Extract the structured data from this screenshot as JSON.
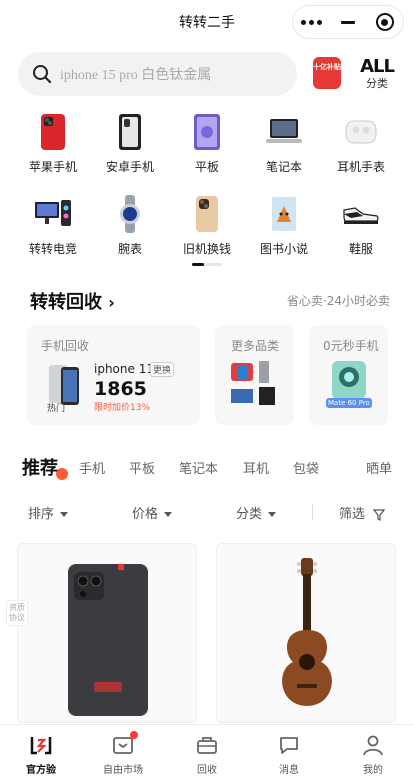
{
  "titlebar": {
    "title": "转转二手"
  },
  "search": {
    "placeholder": "iphone 15 pro 白色钛金属",
    "subsidy_badge": "十亿补贴",
    "all_line1": "ALL",
    "all_line2": "分类"
  },
  "categories": [
    {
      "label": "苹果手机",
      "icon": "iphone-icon"
    },
    {
      "label": "安卓手机",
      "icon": "android-phone-icon"
    },
    {
      "label": "平板",
      "icon": "tablet-icon"
    },
    {
      "label": "笔记本",
      "icon": "laptop-icon"
    },
    {
      "label": "耳机手表",
      "icon": "earbuds-icon"
    },
    {
      "label": "转转电竞",
      "icon": "gaming-pc-icon"
    },
    {
      "label": "腕表",
      "icon": "watch-icon"
    },
    {
      "label": "旧机换钱",
      "icon": "old-phone-icon"
    },
    {
      "label": "图书小说",
      "icon": "book-icon"
    },
    {
      "label": "鞋服",
      "icon": "sneaker-icon"
    }
  ],
  "recycle": {
    "title": "转转回收",
    "subtitle": "省心卖·24小时必卖",
    "phone_card": {
      "title": "手机回收",
      "model": "iphone 11",
      "swap": "更换",
      "price": "1865",
      "hot": "热门",
      "promo": "限时加价13%"
    },
    "more_card": {
      "title": "更多品类"
    },
    "zero_card": {
      "title": "0元秒手机",
      "phone_label": "Mate 60 Pro"
    }
  },
  "tabs": {
    "main": "推荐",
    "items": [
      "手机",
      "平板",
      "笔记本",
      "耳机",
      "包袋",
      "晒单"
    ]
  },
  "filters": {
    "sort": "排序",
    "price": "价格",
    "category": "分类",
    "filter": "筛选"
  },
  "side_note": "资质协议",
  "bottom_nav": [
    {
      "label": "官方验",
      "icon": "official-check-icon"
    },
    {
      "label": "自由市场",
      "icon": "market-icon"
    },
    {
      "label": "回收",
      "icon": "recycle-bag-icon"
    },
    {
      "label": "消息",
      "icon": "message-icon"
    },
    {
      "label": "我的",
      "icon": "profile-icon"
    }
  ],
  "colors": {
    "accent": "#ff5a36",
    "badge_red": "#e53935",
    "price_red": "#ff5a36"
  }
}
